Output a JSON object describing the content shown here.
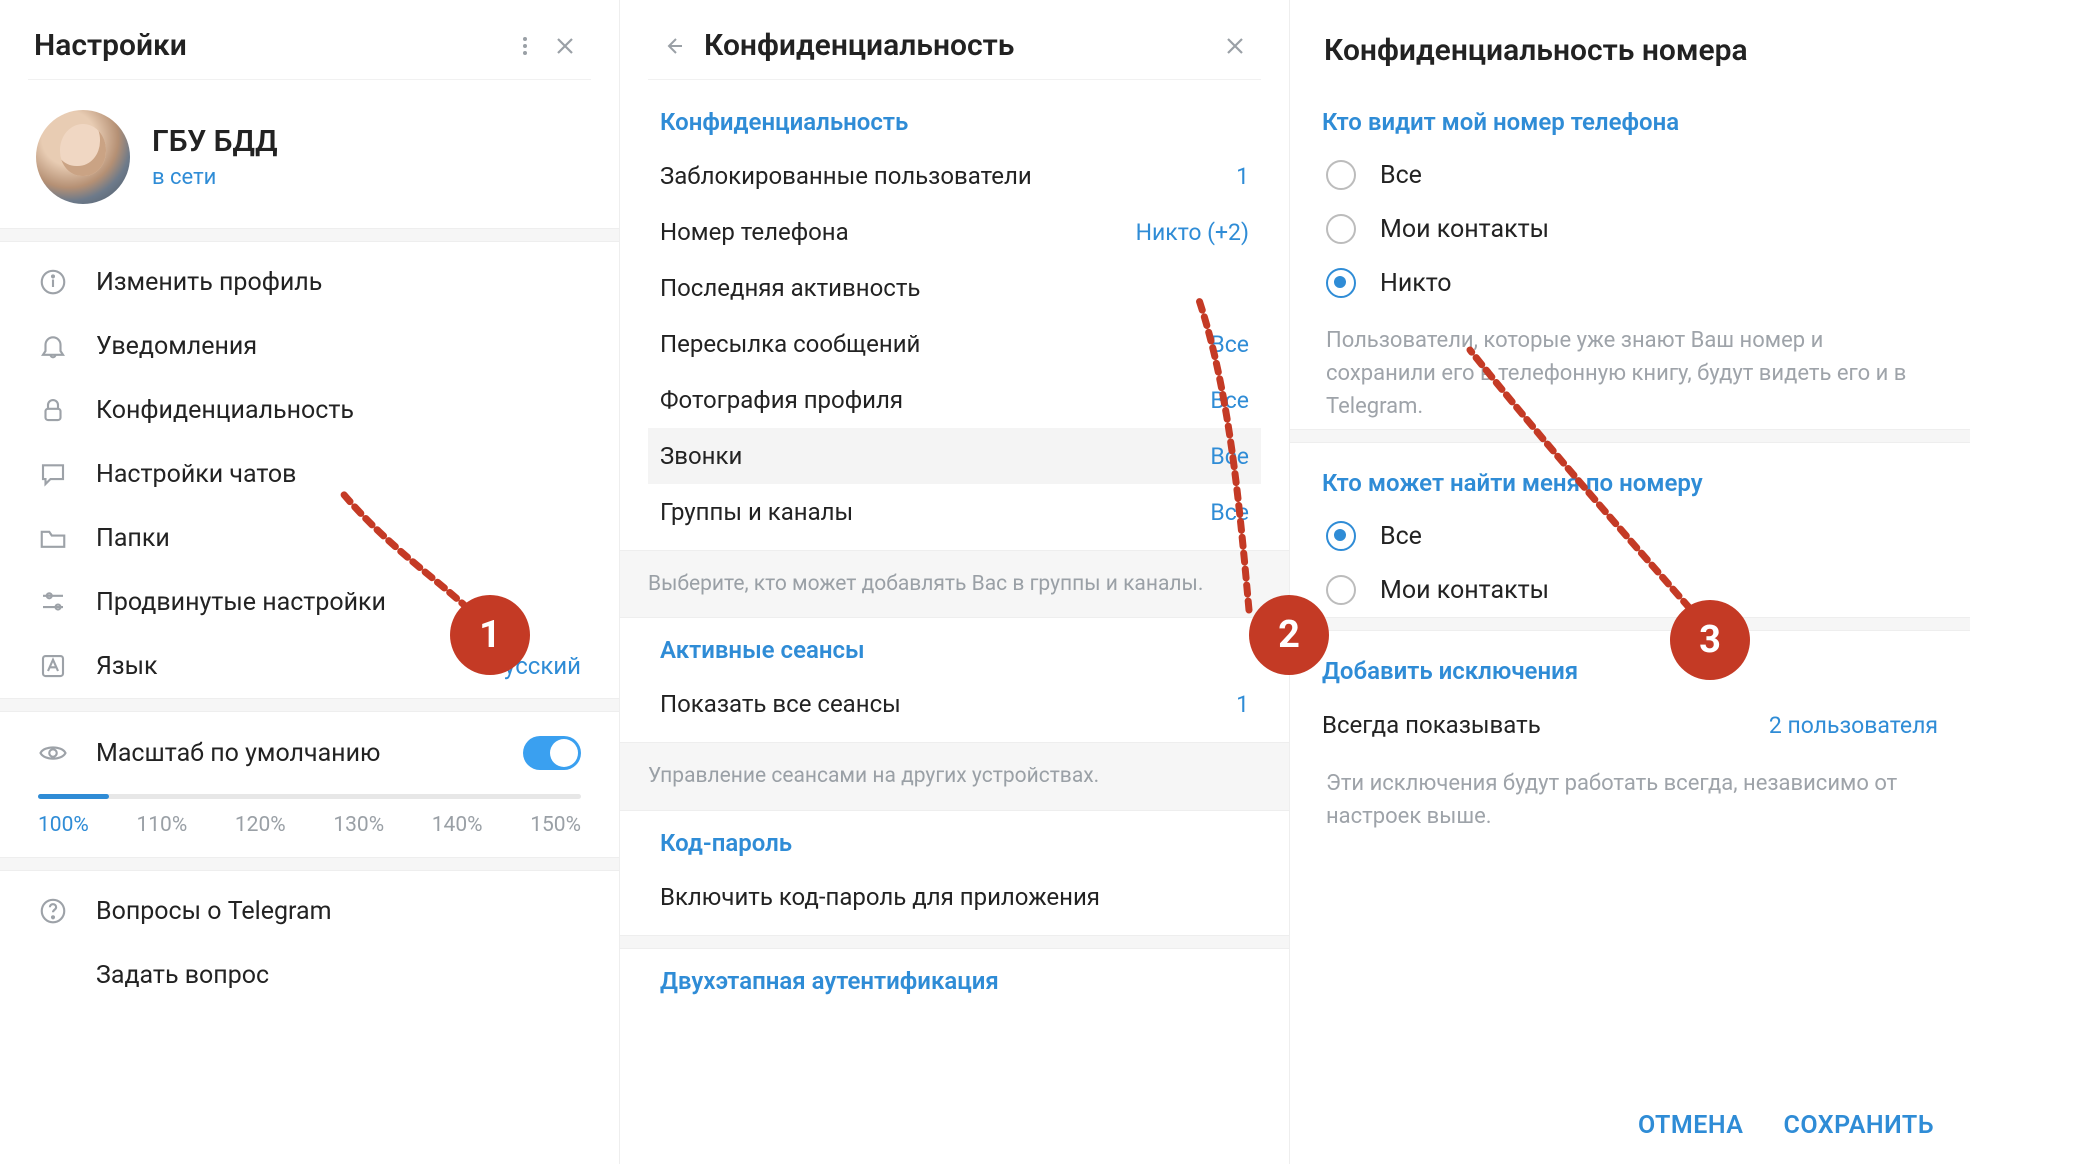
{
  "panel1": {
    "title": "Настройки",
    "profile": {
      "name": "ГБУ БДД",
      "status": "в сети"
    },
    "menu": [
      {
        "label": "Изменить профиль"
      },
      {
        "label": "Уведомления"
      },
      {
        "label": "Конфиденциальность"
      },
      {
        "label": "Настройки чатов"
      },
      {
        "label": "Папки"
      },
      {
        "label": "Продвинутые настройки"
      },
      {
        "label": "Язык",
        "value": "Русский"
      }
    ],
    "zoom_label": "Масштаб по умолчанию",
    "zoom_values": [
      "100%",
      "110%",
      "120%",
      "130%",
      "140%",
      "150%"
    ],
    "faq": "Вопросы о Telegram",
    "ask": "Задать вопрос",
    "step": "1"
  },
  "panel2": {
    "title": "Конфиденциальность",
    "privacy_heading": "Конфиденциальность",
    "rows": [
      {
        "label": "Заблокированные пользователи",
        "value": "1"
      },
      {
        "label": "Номер телефона",
        "value": "Никто (+2)"
      },
      {
        "label": "Последняя активность",
        "value": ""
      },
      {
        "label": "Пересылка сообщений",
        "value": "Все"
      },
      {
        "label": "Фотография профиля",
        "value": "Все"
      },
      {
        "label": "Звонки",
        "value": "Все",
        "hl": true
      },
      {
        "label": "Группы и каналы",
        "value": "Все"
      }
    ],
    "hint1": "Выберите, кто может добавлять Вас в группы и каналы.",
    "sessions_heading": "Активные сеансы",
    "sessions_row": "Показать все сеансы",
    "sessions_value": "1",
    "hint2": "Управление сеансами на других устройствах.",
    "passcode_heading": "Код-пароль",
    "passcode_row": "Включить код-пароль для приложения",
    "twofa_heading": "Двухэтапная аутентификация",
    "step": "2"
  },
  "panel3": {
    "title": "Конфиденциальность номера",
    "who_sees_heading": "Кто видит мой номер телефона",
    "who_sees_options": [
      "Все",
      "Мои контакты",
      "Никто"
    ],
    "who_sees_selected": 2,
    "who_sees_desc": "Пользователи, которые уже знают Ваш номер и сохранили его в телефонную книгу, будут видеть его и в Telegram.",
    "who_finds_heading": "Кто может найти меня по номеру",
    "who_finds_options": [
      "Все",
      "Мои контакты"
    ],
    "who_finds_selected": 0,
    "exceptions_heading": "Добавить исключения",
    "exceptions_row": "Всегда показывать",
    "exceptions_value": "2 пользователя",
    "exceptions_desc": "Эти исключения будут работать всегда, независимо от настроек выше.",
    "cancel": "ОТМЕНА",
    "save": "СОХРАНИТЬ",
    "step": "3"
  }
}
